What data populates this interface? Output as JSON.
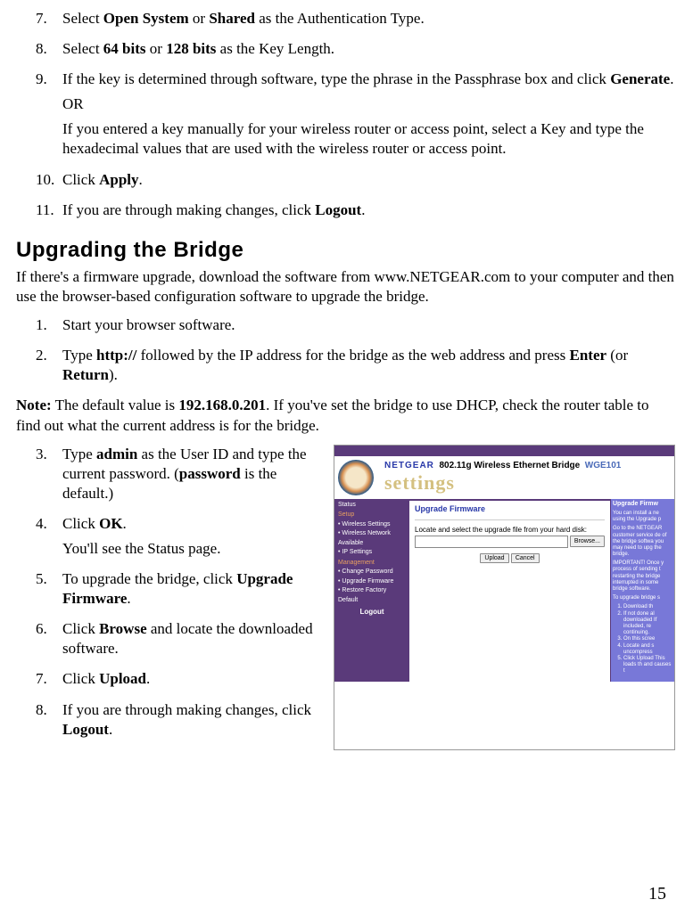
{
  "steps_upper": [
    {
      "n": "7.",
      "parts": [
        {
          "t": "Select "
        },
        {
          "t": "Open System",
          "b": true
        },
        {
          "t": " or "
        },
        {
          "t": "Shared",
          "b": true
        },
        {
          "t": " as the Authentication Type."
        }
      ]
    },
    {
      "n": "8.",
      "parts": [
        {
          "t": "Select "
        },
        {
          "t": "64 bits",
          "b": true
        },
        {
          "t": " or "
        },
        {
          "t": "128 bits",
          "b": true
        },
        {
          "t": " as the Key Length."
        }
      ]
    },
    {
      "n": "9.",
      "paras": [
        [
          {
            "t": "If the key is determined through software, type the phrase in the Passphrase box and click "
          },
          {
            "t": "Generate",
            "b": true
          },
          {
            "t": "."
          }
        ],
        [
          {
            "t": "OR"
          }
        ],
        [
          {
            "t": "If you entered a key manually for your wireless router or access point, select a Key and type the hexadecimal values that are used with the wireless router or access point."
          }
        ]
      ]
    },
    {
      "n": "10.",
      "parts": [
        {
          "t": "Click "
        },
        {
          "t": "Apply",
          "b": true
        },
        {
          "t": "."
        }
      ]
    },
    {
      "n": "11.",
      "parts": [
        {
          "t": "If you are through making changes, click "
        },
        {
          "t": "Logout",
          "b": true
        },
        {
          "t": "."
        }
      ]
    }
  ],
  "heading": "Upgrading the Bridge",
  "intro": "If there's a firmware upgrade, download the software from www.NETGEAR.com to your computer and then use the browser-based configuration software to upgrade the bridge.",
  "steps_mid": [
    {
      "n": "1.",
      "parts": [
        {
          "t": "Start your browser software."
        }
      ]
    },
    {
      "n": "2.",
      "parts": [
        {
          "t": "Type "
        },
        {
          "t": "http://",
          "b": true
        },
        {
          "t": " followed by the IP address for the bridge as the web address and press "
        },
        {
          "t": "Enter",
          "b": true
        },
        {
          "t": " (or "
        },
        {
          "t": "Return",
          "b": true
        },
        {
          "t": ")."
        }
      ]
    }
  ],
  "note_parts": [
    {
      "t": "Note:",
      "b": true
    },
    {
      "t": " The default value is "
    },
    {
      "t": "192.168.0.201",
      "b": true
    },
    {
      "t": ". If you've set the bridge to use DHCP, check the router table to find out what the current address is for the bridge."
    }
  ],
  "steps_lower": [
    {
      "n": "3.",
      "paras": [
        [
          {
            "t": "Type "
          },
          {
            "t": "admin",
            "b": true
          },
          {
            "t": " as the User ID and type the current password. ("
          },
          {
            "t": "password",
            "b": true
          },
          {
            "t": " is the default.)"
          }
        ]
      ]
    },
    {
      "n": "4.",
      "paras": [
        [
          {
            "t": "Click "
          },
          {
            "t": "OK",
            "b": true
          },
          {
            "t": "."
          }
        ],
        [
          {
            "t": "You'll see the Status page."
          }
        ]
      ]
    },
    {
      "n": "5.",
      "paras": [
        [
          {
            "t": "To upgrade the bridge, click "
          },
          {
            "t": "Upgrade Firmware",
            "b": true
          },
          {
            "t": "."
          }
        ]
      ]
    },
    {
      "n": "6.",
      "paras": [
        [
          {
            "t": "Click "
          },
          {
            "t": "Browse",
            "b": true
          },
          {
            "t": " and locate the downloaded software."
          }
        ]
      ]
    },
    {
      "n": "7.",
      "paras": [
        [
          {
            "t": "Click "
          },
          {
            "t": "Upload",
            "b": true
          },
          {
            "t": "."
          }
        ]
      ]
    },
    {
      "n": "8.",
      "paras": [
        [
          {
            "t": "If you are through making changes, click "
          },
          {
            "t": "Logout",
            "b": true
          },
          {
            "t": "."
          }
        ]
      ]
    }
  ],
  "screenshot": {
    "brand": "NETGEAR",
    "product": "802.11g Wireless Ethernet Bridge",
    "model": "WGE101",
    "settings_word": "settings",
    "nav": {
      "status": "Status",
      "setup": "Setup",
      "setup_items": [
        "Wireless Settings",
        "Wireless Network Available",
        "IP Settings"
      ],
      "management": "Management",
      "mgmt_items": [
        "Change Password",
        "Upgrade Firmware",
        "Restore Factory Default"
      ],
      "logout": "Logout"
    },
    "panel": {
      "title": "Upgrade Firmware",
      "instruction": "Locate and select the upgrade file from your hard disk:",
      "browse": "Browse...",
      "upload": "Upload",
      "cancel": "Cancel"
    },
    "help": {
      "title": "Upgrade Firmw",
      "p1": "You can install a ne using the Upgrade p",
      "p2": "Go to the NETGEAR customer service de of the bridge softwa you may need to upg the bridge.",
      "p3": "IMPORTANT! Once y process of sending t restarting the bridge interrupted in some bridge software.",
      "p4": "To upgrade bridge s",
      "li1": "Download th",
      "li2": "If not done al downloaded If included, re continuing.",
      "li3": "On this scree",
      "li4": "Locate and s uncompress",
      "li5": "Click Upload This loads th and causes t"
    }
  },
  "page_number": "15"
}
